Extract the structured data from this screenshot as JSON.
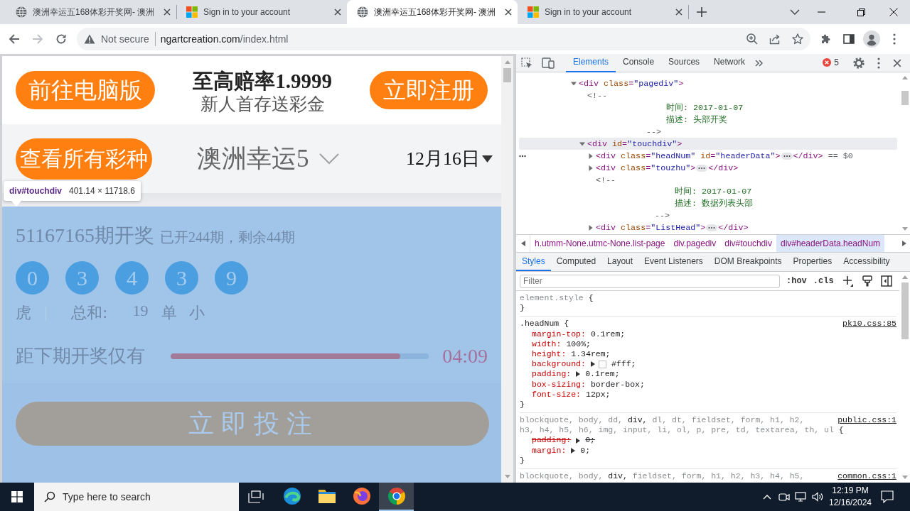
{
  "browser": {
    "tabs": [
      {
        "kind": "site",
        "title": "澳洲幸运五168体彩开奖网- 澳洲",
        "selected": false
      },
      {
        "kind": "microsoft",
        "title": "Sign in to your account",
        "selected": false
      },
      {
        "kind": "site",
        "title": "澳洲幸运五168体彩开奖网- 澳洲",
        "selected": true
      },
      {
        "kind": "microsoft",
        "title": "Sign in to your account",
        "selected": false
      }
    ],
    "nav": [
      {
        "kind": "back",
        "disabled": false
      },
      {
        "kind": "forward",
        "disabled": true
      },
      {
        "kind": "reload",
        "disabled": false
      }
    ],
    "address": {
      "security": "Not secure",
      "host": "ngartcreation.com",
      "path": "/index.html"
    }
  },
  "page": {
    "header": {
      "left_button": "前往电脑版",
      "promo_title": "至高赔率1.9999",
      "promo_subtitle": "新人首存送彩金",
      "right_button": "立即注册"
    },
    "lottery_bar": {
      "all_button": "查看所有彩种",
      "game": "澳洲幸运5",
      "date": "12月16日"
    },
    "inspect_tooltip": {
      "selector": "div#touchdiv",
      "size": "401.14 × 11718.6"
    },
    "draw": {
      "issue": "51167165期开奖",
      "progress": "已开244期，剩余44期",
      "balls": [
        "0",
        "3",
        "4",
        "3",
        "9"
      ],
      "summary": [
        {
          "kind": "zodiac",
          "text": "虎"
        },
        {
          "kind": "label",
          "text": "总和:"
        },
        {
          "kind": "number",
          "text": "19"
        },
        {
          "kind": "tag",
          "text": "单"
        },
        {
          "kind": "tag",
          "text": "小"
        }
      ],
      "countdown": {
        "label": "距下期开奖仅有",
        "level": 0.89,
        "time": "04:09"
      }
    },
    "bet_button": "立即投注"
  },
  "devtools": {
    "tabs": [
      {
        "label": "Elements",
        "selected": true
      },
      {
        "label": "Console",
        "selected": false
      },
      {
        "label": "Sources",
        "selected": false
      },
      {
        "label": "Network",
        "selected": false
      }
    ],
    "error_count": "5",
    "dom": [
      {
        "kind": "element",
        "open": "<div class=\"pagediv\">",
        "expanded": true,
        "hovered": false,
        "selected": false,
        "children": [
          {
            "kind": "comment",
            "lines": [
              {
                "kind": "open",
                "text": "<!--"
              },
              {
                "kind": "body",
                "text": "时间: 2017-01-07"
              },
              {
                "kind": "body",
                "text": "描述: 头部开奖"
              },
              {
                "kind": "close",
                "text": "-->"
              }
            ]
          },
          {
            "kind": "element",
            "open": "<div id=\"touchdiv\">",
            "expanded": true,
            "hovered": true,
            "selected": false,
            "children": [
              {
                "kind": "element",
                "open": "<div class=\"headNum\" id=\"headerData\">",
                "close": "</div>",
                "expanded": false,
                "hovered": false,
                "selected": true,
                "console_ref": "== $0"
              },
              {
                "kind": "element",
                "open": "<div class=\"touzhu\">",
                "close": "</div>",
                "expanded": false,
                "hovered": false,
                "selected": false
              },
              {
                "kind": "comment",
                "lines": [
                  {
                    "kind": "open",
                    "text": "<!--"
                  },
                  {
                    "kind": "body",
                    "text": "时间: 2017-01-07"
                  },
                  {
                    "kind": "body",
                    "text": "描述: 数据列表头部"
                  },
                  {
                    "kind": "close",
                    "text": "-->"
                  }
                ]
              },
              {
                "kind": "element",
                "open": "<div class=\"ListHead\">",
                "close": "</div>",
                "expanded": false,
                "hovered": false,
                "selected": false
              }
            ]
          }
        ]
      }
    ],
    "breadcrumbs": [
      {
        "label": "h.utmm-None.utmc-None.list-page",
        "selected": false
      },
      {
        "label": "div.pagediv",
        "selected": false
      },
      {
        "label": "div#touchdiv",
        "selected": false
      },
      {
        "label": "div#headerData.headNum",
        "selected": true
      }
    ],
    "sidebar_tabs": [
      {
        "label": "Styles",
        "selected": true
      },
      {
        "label": "Computed",
        "selected": false
      },
      {
        "label": "Layout",
        "selected": false
      },
      {
        "label": "Event Listeners",
        "selected": false
      },
      {
        "label": "DOM Breakpoints",
        "selected": false
      },
      {
        "label": "Properties",
        "selected": false
      },
      {
        "label": "Accessibility",
        "selected": false
      }
    ],
    "filter": {
      "placeholder": "Filter"
    },
    "style_toggles": [
      ":hov",
      ".cls"
    ],
    "rules": [
      {
        "selectors": [
          {
            "text": "element.style",
            "matched": false
          }
        ],
        "open": "{",
        "close": "}"
      },
      {
        "selectors": [
          {
            "text": ".headNum",
            "matched": true
          }
        ],
        "open": "{",
        "source": "pk10.css:85",
        "declarations": [
          {
            "property": "margin-top:",
            "value": "0.1rem;",
            "expandable": false,
            "overridden": false
          },
          {
            "property": "width:",
            "value": "100%;",
            "expandable": false,
            "overridden": false
          },
          {
            "property": "height:",
            "value": "1.34rem;",
            "expandable": false,
            "overridden": false
          },
          {
            "property": "background:",
            "value": "#fff;",
            "expandable": true,
            "overridden": false,
            "color": "#ffffff"
          },
          {
            "property": "padding:",
            "value": "0.1rem;",
            "expandable": true,
            "overridden": false
          },
          {
            "property": "box-sizing:",
            "value": "border-box;",
            "expandable": false,
            "overridden": false
          },
          {
            "property": "font-size:",
            "value": "12px;",
            "expandable": false,
            "overridden": false
          }
        ],
        "close": "}"
      },
      {
        "selectors": [
          {
            "text": "blockquote,",
            "matched": false
          },
          {
            "text": "body,",
            "matched": false
          },
          {
            "text": "dd,",
            "matched": false
          },
          {
            "text": "div,",
            "matched": true
          },
          {
            "text": "dl,",
            "matched": false
          },
          {
            "text": "dt,",
            "matched": false
          },
          {
            "text": "fieldset,",
            "matched": false
          },
          {
            "text": "form,",
            "matched": false
          },
          {
            "text": "h1,",
            "matched": false
          },
          {
            "text": "h2,",
            "matched": false
          },
          {
            "text": "h3,",
            "matched": false
          },
          {
            "text": "h4,",
            "matched": false
          },
          {
            "text": "h5,",
            "matched": false
          },
          {
            "text": "h6,",
            "matched": false
          },
          {
            "text": "img,",
            "matched": false
          },
          {
            "text": "input,",
            "matched": false
          },
          {
            "text": "li,",
            "matched": false
          },
          {
            "text": "ol,",
            "matched": false
          },
          {
            "text": "p,",
            "matched": false
          },
          {
            "text": "pre,",
            "matched": false
          },
          {
            "text": "td,",
            "matched": false
          },
          {
            "text": "textarea,",
            "matched": false
          },
          {
            "text": "th,",
            "matched": false
          },
          {
            "text": "ul",
            "matched": false
          }
        ],
        "open": "{",
        "source": "public.css:1",
        "declarations": [
          {
            "property": "padding:",
            "value": "0;",
            "expandable": true,
            "overridden": true
          },
          {
            "property": "margin:",
            "value": "0;",
            "expandable": true,
            "overridden": false
          }
        ],
        "close": "}"
      },
      {
        "selectors": [
          {
            "text": "blockquote,",
            "matched": false
          },
          {
            "text": "body,",
            "matched": false
          },
          {
            "text": "div,",
            "matched": true
          },
          {
            "text": "fieldset,",
            "matched": false
          },
          {
            "text": "form,",
            "matched": false
          },
          {
            "text": "h1,",
            "matched": false
          },
          {
            "text": "h2,",
            "matched": false
          },
          {
            "text": "h3,",
            "matched": false
          },
          {
            "text": "h4,",
            "matched": false
          },
          {
            "text": "h5,",
            "matched": false
          }
        ],
        "source": "common.css:1"
      }
    ]
  },
  "taskbar": {
    "search_placeholder": "Type here to search",
    "apps": [
      {
        "kind": "task-view",
        "active": false
      },
      {
        "kind": "edge",
        "active": false
      },
      {
        "kind": "explorer",
        "active": false
      },
      {
        "kind": "firefox",
        "active": false
      },
      {
        "kind": "chrome",
        "active": true
      }
    ],
    "time": "12:19 PM",
    "date": "12/16/2024"
  }
}
